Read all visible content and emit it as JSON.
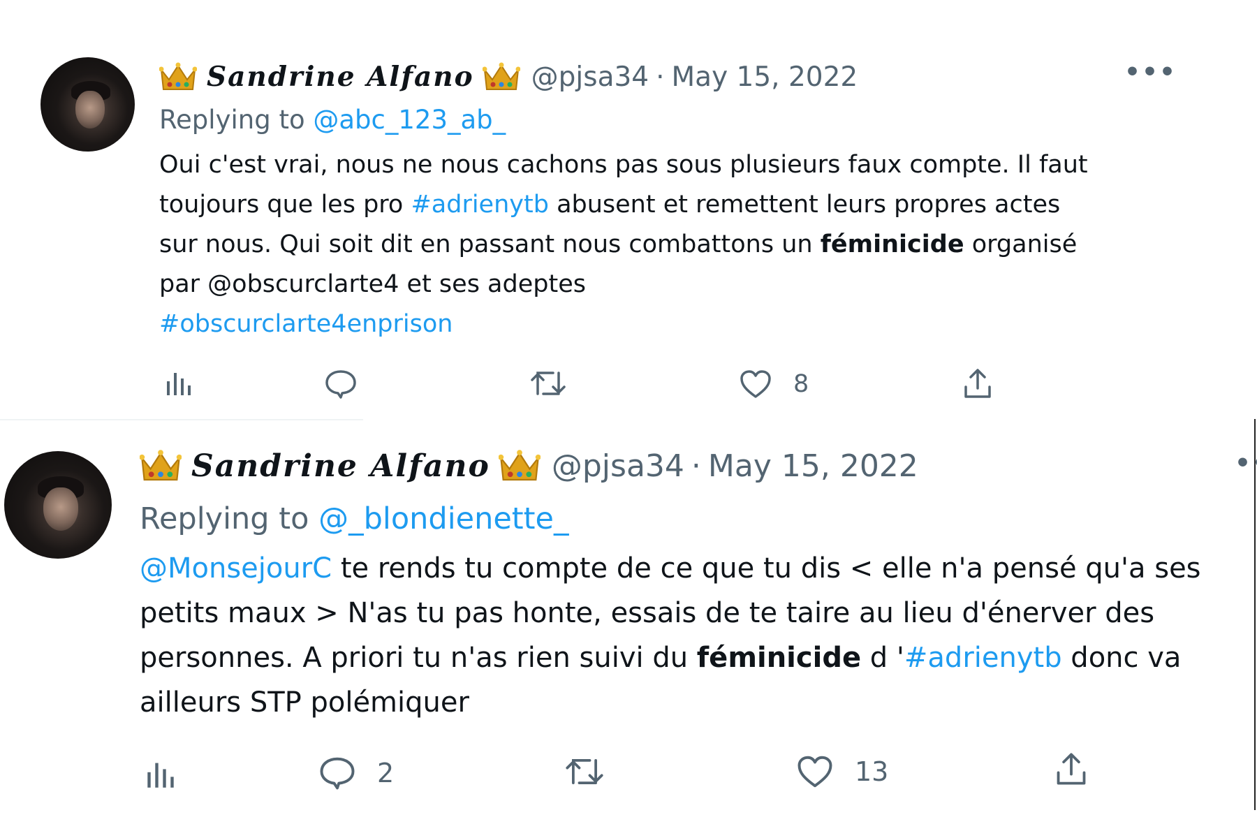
{
  "tweets": [
    {
      "display_name": "Sandrine Alfano",
      "handle": "@pjsa34",
      "separator": "·",
      "date": "May 15, 2022",
      "more_label": "•••",
      "replying_prefix": "Replying to",
      "replying_to": "@abc_123_ab_",
      "body": {
        "l1": "Oui c'est vrai, nous ne nous cachons pas sous plusieurs faux compte. Il faut",
        "l2_a": "toujours que les pro ",
        "l2_tag": "#adrienytb",
        "l2_b": " abusent et remettent leurs propres actes",
        "l3_a": "sur nous. Qui soit dit en passant nous combattons un ",
        "l3_bold": "féminicide",
        "l3_b": " organisé",
        "l4": "par @obscurclarte4 et ses adeptes",
        "l5_tag": "#obscurclarte4enprison"
      },
      "actions": {
        "views_icon": "bar-chart-icon",
        "reply_icon": "speech-bubble-icon",
        "reply_count": "",
        "retweet_icon": "retweet-icon",
        "retweet_count": "",
        "like_icon": "heart-icon",
        "like_count": "8",
        "share_icon": "share-upload-icon"
      }
    },
    {
      "display_name": "Sandrine Alfano",
      "handle": "@pjsa34",
      "separator": "·",
      "date": "May 15, 2022",
      "more_label": "••",
      "replying_prefix": "Replying to",
      "replying_to": "@_blondienette_",
      "body": {
        "l1_mention": "@MonsejourC",
        "l1_b": " te rends tu compte de ce que tu dis < elle n'a pensé qu'a ses",
        "l2": "petits maux > N'as tu pas honte, essais de te taire au lieu d'énerver des",
        "l3_a": "personnes. A priori tu n'as rien suivi du ",
        "l3_bold": "féminicide",
        "l3_b": " d '",
        "l3_tag": "#adrienytb",
        "l3_c": " donc va",
        "l4": "ailleurs STP polémiquer"
      },
      "actions": {
        "views_icon": "bar-chart-icon",
        "reply_icon": "speech-bubble-icon",
        "reply_count": "2",
        "retweet_icon": "retweet-icon",
        "retweet_count": "",
        "like_icon": "heart-icon",
        "like_count": "13",
        "share_icon": "share-upload-icon"
      }
    }
  ],
  "colors": {
    "link": "#1d9bf0",
    "secondary": "#536471",
    "text": "#0f1419",
    "crown_gold": "#e0a21a"
  }
}
